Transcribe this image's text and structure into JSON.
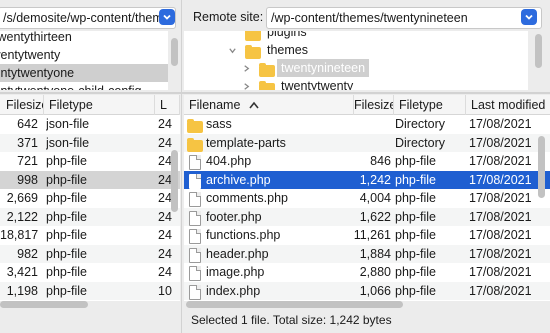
{
  "local": {
    "path_value": "/s/demosite/wp-content/themes",
    "tree": [
      "twentythirteen",
      "twentytwenty",
      "twentytwentyone",
      "twentytwentyone-child-config"
    ],
    "selected_tree_index": 2,
    "columns": [
      "Filesize",
      "Filetype",
      "L"
    ],
    "files": [
      {
        "size": "642",
        "type": "json-file",
        "mod": "24"
      },
      {
        "size": "371",
        "type": "json-file",
        "mod": "24"
      },
      {
        "size": "721",
        "type": "php-file",
        "mod": "24"
      },
      {
        "size": "998",
        "type": "php-file",
        "mod": "24"
      },
      {
        "size": "2,669",
        "type": "php-file",
        "mod": "24"
      },
      {
        "size": "2,122",
        "type": "php-file",
        "mod": "24"
      },
      {
        "size": "18,817",
        "type": "php-file",
        "mod": "24"
      },
      {
        "size": "982",
        "type": "php-file",
        "mod": "24"
      },
      {
        "size": "3,421",
        "type": "php-file",
        "mod": "24"
      },
      {
        "size": "1,198",
        "type": "php-file",
        "mod": "10"
      }
    ],
    "selected_file_index": 3
  },
  "remote": {
    "label": "Remote site:",
    "path_value": "/wp-content/themes/twentynineteen",
    "tree": [
      {
        "name": "plugins",
        "indent": 1,
        "arrow": "",
        "partial": true
      },
      {
        "name": "themes",
        "indent": 1,
        "arrow": "down"
      },
      {
        "name": "twentynineteen",
        "indent": 2,
        "arrow": "right",
        "selected": true
      },
      {
        "name": "twentytwenty",
        "indent": 2,
        "arrow": "right"
      }
    ],
    "columns": [
      "Filename",
      "Filesize",
      "Filetype",
      "Last modified"
    ],
    "files": [
      {
        "name": "sass",
        "size": "",
        "type": "Directory",
        "date": "17/08/2021",
        "kind": "folder"
      },
      {
        "name": "template-parts",
        "size": "",
        "type": "Directory",
        "date": "17/08/2021",
        "kind": "folder"
      },
      {
        "name": "404.php",
        "size": "846",
        "type": "php-file",
        "date": "17/08/2021",
        "kind": "file"
      },
      {
        "name": "archive.php",
        "size": "1,242",
        "type": "php-file",
        "date": "17/08/2021",
        "kind": "file"
      },
      {
        "name": "comments.php",
        "size": "4,004",
        "type": "php-file",
        "date": "17/08/2021",
        "kind": "file"
      },
      {
        "name": "footer.php",
        "size": "1,622",
        "type": "php-file",
        "date": "17/08/2021",
        "kind": "file"
      },
      {
        "name": "functions.php",
        "size": "11,261",
        "type": "php-file",
        "date": "17/08/2021",
        "kind": "file"
      },
      {
        "name": "header.php",
        "size": "1,884",
        "type": "php-file",
        "date": "17/08/2021",
        "kind": "file"
      },
      {
        "name": "image.php",
        "size": "2,880",
        "type": "php-file",
        "date": "17/08/2021",
        "kind": "file"
      },
      {
        "name": "index.php",
        "size": "1,066",
        "type": "php-file",
        "date": "17/08/2021",
        "kind": "file"
      }
    ],
    "selected_file_index": 3,
    "status": "Selected 1 file. Total size: 1,242 bytes"
  },
  "icons": {
    "dropdown": "chevron-down-icon",
    "folder": "folder-icon",
    "file": "file-icon",
    "sort": "sort-ascending-icon"
  }
}
